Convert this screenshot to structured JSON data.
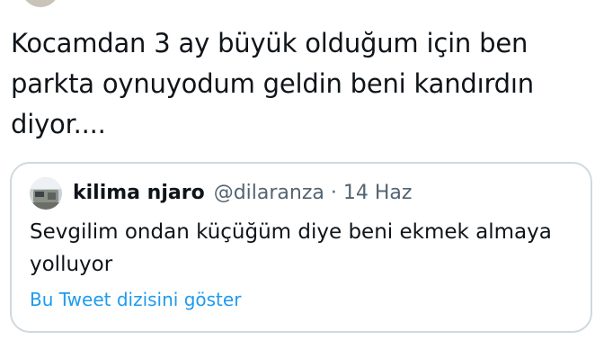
{
  "tweet": {
    "text": "Kocamdan 3 ay büyük olduğum için ben parkta oynuyodum geldin beni kandırdın diyor...."
  },
  "quote": {
    "author_name": "kilima njaro",
    "author_handle": "@dilaranza",
    "separator": "·",
    "date": "14 Haz",
    "text": "Sevgilim ondan küçüğüm diye beni ekmek almaya yolluyor",
    "show_thread_link": "Bu Tweet dizisini göster",
    "avatar_icon": "profile-photo-icon"
  },
  "colors": {
    "text": "#0f1419",
    "secondary_text": "#536471",
    "link": "#1d9bf0",
    "card_border": "#cfd9de"
  }
}
